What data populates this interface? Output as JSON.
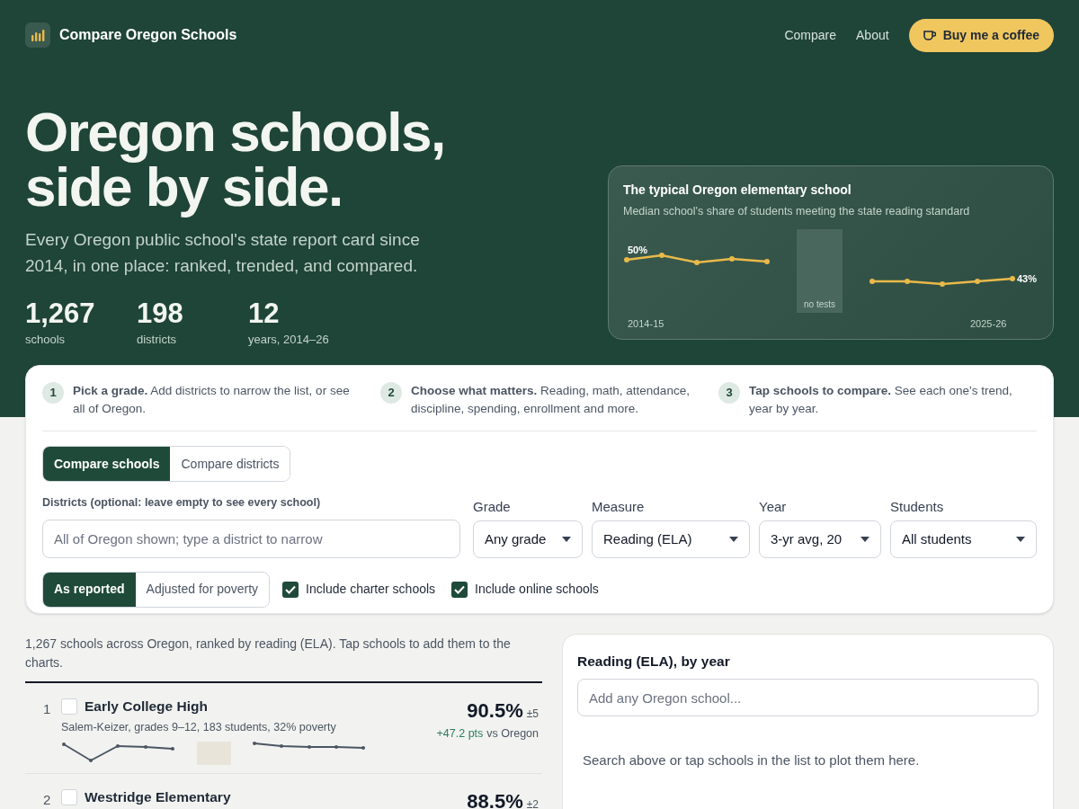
{
  "nav": {
    "brand": "Compare Oregon Schools",
    "links": [
      {
        "label": "Compare"
      },
      {
        "label": "About"
      }
    ],
    "cta": "Buy me a coffee"
  },
  "hero": {
    "title_lines": [
      "Oregon schools,",
      "side by side."
    ],
    "subtitle": "Every Oregon public school's state report card since 2014, in one place: ranked, trended, and compared.",
    "stats": [
      {
        "value": "1,267",
        "label": "schools"
      },
      {
        "value": "198",
        "label": "districts"
      },
      {
        "value": "12",
        "label": "years, 2014–26"
      }
    ],
    "chart_card": {
      "title": "The typical Oregon elementary school",
      "subtitle": "Median school's share of students meeting the state reading standard",
      "start_value": "50%",
      "end_value": "43%",
      "gap_label": "no tests",
      "start_year": "2014-15",
      "end_year": "2025-26"
    }
  },
  "steps": [
    {
      "number": "1",
      "text": "**Pick a grade.** Add districts to narrow the list, or see all of Oregon."
    },
    {
      "number": "2",
      "text": "**Choose what matters.** Reading, math, attendance, discipline, spending, enrollment and more."
    },
    {
      "number": "3",
      "text": "**Tap schools to compare.** See each one's trend, year by year."
    }
  ],
  "mode_tabs": [
    {
      "label": "Compare schools",
      "selected": true
    },
    {
      "label": "Compare districts",
      "selected": false
    }
  ],
  "district_field": {
    "label": "Districts (optional: leave empty to see every school)",
    "placeholder": "All of Oregon shown; type a district to narrow"
  },
  "selects": [
    {
      "label": "Grade",
      "value": "Any grade"
    },
    {
      "label": "Measure",
      "value": "Reading (ELA)"
    },
    {
      "label": "Year",
      "value": "3-yr avg, 20"
    },
    {
      "label": "Students",
      "value": "All students"
    }
  ],
  "adjustment_tabs": [
    {
      "label": "As reported",
      "selected": true
    },
    {
      "label": "Adjusted for poverty",
      "selected": false
    }
  ],
  "checkboxes": [
    {
      "label": "Include charter schools",
      "checked": true
    },
    {
      "label": "Include online schools",
      "checked": true
    }
  ],
  "results": {
    "summary": "1,267 schools across Oregon, ranked by reading (ELA). Tap schools to add them to the charts.",
    "rows": [
      {
        "rank": "1",
        "name": "Early College High",
        "details": "Salem-Keizer, grades 9–12, 183 students, 32% poverty",
        "value": "90.5%",
        "margin": "±5",
        "diff": "+47.2 pts",
        "diff_suffix": "vs Oregon",
        "checked": false,
        "trend_shown": true
      },
      {
        "rank": "2",
        "name": "Westridge Elementary",
        "value": "88.5%",
        "margin": "±2",
        "checked": false,
        "trend_shown": false
      }
    ]
  },
  "compare_panel": {
    "title": "Reading (ELA), by year",
    "search_placeholder": "Add any Oregon school...",
    "empty_message": "Search above or tap schools in the list to plot them here."
  }
}
